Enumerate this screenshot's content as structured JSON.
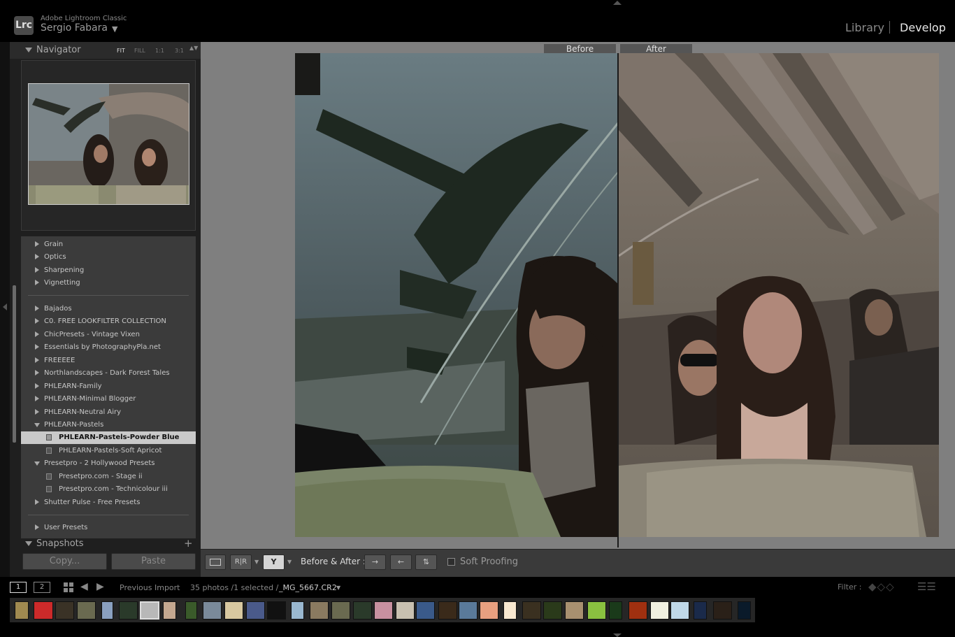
{
  "header": {
    "app_name": "Adobe Lightroom Classic",
    "logo_text": "Lrc",
    "user": "Sergio Fabara",
    "user_caret": "▼",
    "modules": [
      "Library",
      "Develop"
    ],
    "active_module": "Develop"
  },
  "navigator": {
    "title": "Navigator",
    "zoom_options": [
      "FIT",
      "FILL",
      "1:1",
      "3:1"
    ],
    "active_zoom": "FIT",
    "zoom_stepper": "▲▼"
  },
  "presets": {
    "items": [
      {
        "label": "Grain",
        "type": "collapsed"
      },
      {
        "label": "Optics",
        "type": "collapsed"
      },
      {
        "label": "Sharpening",
        "type": "collapsed"
      },
      {
        "label": "Vignetting",
        "type": "collapsed"
      },
      {
        "label": "Bajados",
        "type": "collapsed"
      },
      {
        "label": "C0. FREE LOOKFILTER COLLECTION",
        "type": "collapsed"
      },
      {
        "label": "ChicPresets - Vintage Vixen",
        "type": "collapsed"
      },
      {
        "label": "Essentials by PhotographyPla.net",
        "type": "collapsed"
      },
      {
        "label": "FREEEEE",
        "type": "collapsed"
      },
      {
        "label": "Northlandscapes - Dark Forest Tales",
        "type": "collapsed"
      },
      {
        "label": "PHLEARN-Family",
        "type": "collapsed"
      },
      {
        "label": "PHLEARN-Minimal Blogger",
        "type": "collapsed"
      },
      {
        "label": "PHLEARN-Neutral Airy",
        "type": "collapsed"
      },
      {
        "label": "PHLEARN-Pastels",
        "type": "expanded"
      },
      {
        "label": "PHLEARN-Pastels-Powder Blue",
        "type": "preset",
        "selected": true
      },
      {
        "label": "PHLEARN-Pastels-Soft Apricot",
        "type": "preset"
      },
      {
        "label": "Presetpro - 2 Hollywood Presets",
        "type": "expanded"
      },
      {
        "label": "Presetpro.com - Stage ii",
        "type": "preset"
      },
      {
        "label": "Presetpro.com - Technicolour iii",
        "type": "preset"
      },
      {
        "label": "Shutter Pulse - Free Presets",
        "type": "collapsed"
      },
      {
        "label": "User Presets",
        "type": "collapsed"
      }
    ]
  },
  "snapshots": {
    "title": "Snapshots",
    "add": "+"
  },
  "left_buttons": {
    "copy": "Copy...",
    "paste": "Paste"
  },
  "view": {
    "before_label": "Before",
    "after_label": "After"
  },
  "toolbar": {
    "ba_mode_lr": "R|R",
    "ba_mode_ys": "Y",
    "caret": "▼",
    "before_after_label": "Before & After :",
    "copy_before_to_after": "→",
    "copy_after_to_before": "←",
    "swap": "⇅",
    "soft_proofing": "Soft Proofing"
  },
  "filmstrip_bar": {
    "view1": "1",
    "view2": "2",
    "prev": "◀",
    "next": "▶",
    "source": "Previous Import",
    "count": "35 photos /1 selected /",
    "filename": "_MG_5667.CR2",
    "file_caret": "▼",
    "filter_label": "Filter :",
    "filter_icons": "◆◇◇",
    "filter_sliders": "☰☰"
  },
  "colors": {
    "panel_dark": "#1f1f1f",
    "panel_list": "#3b3b3b",
    "main_bg": "#7f7f7f",
    "selection": "#c9c9c9",
    "label_bg": "#555555"
  },
  "filmstrip": {
    "thumb_colors": [
      "#a08a50",
      "#cc2a2a",
      "#3a3226",
      "#6a6a50",
      "#8aa0c0",
      "#2a3a2a",
      "#b8b8b8",
      "#c4a890",
      "#3a5a2a",
      "#7a8a9a",
      "#d8c8a0",
      "#4a5a8a",
      "#111111",
      "#9ab8d0",
      "#8a7a60",
      "#6a6a50",
      "#2a3a2a",
      "#c890a0",
      "#c8c0b0",
      "#3a5a8a",
      "#3a2a1a",
      "#5a7a9a",
      "#e8a080",
      "#f8e8d0",
      "#3a3020",
      "#2a3a1a",
      "#a89070",
      "#8ac040",
      "#1a3a1a",
      "#a03010",
      "#f0f0e0",
      "#c0d8e8",
      "#1a2a4a",
      "#2a2018",
      "#0a1a2a"
    ]
  }
}
